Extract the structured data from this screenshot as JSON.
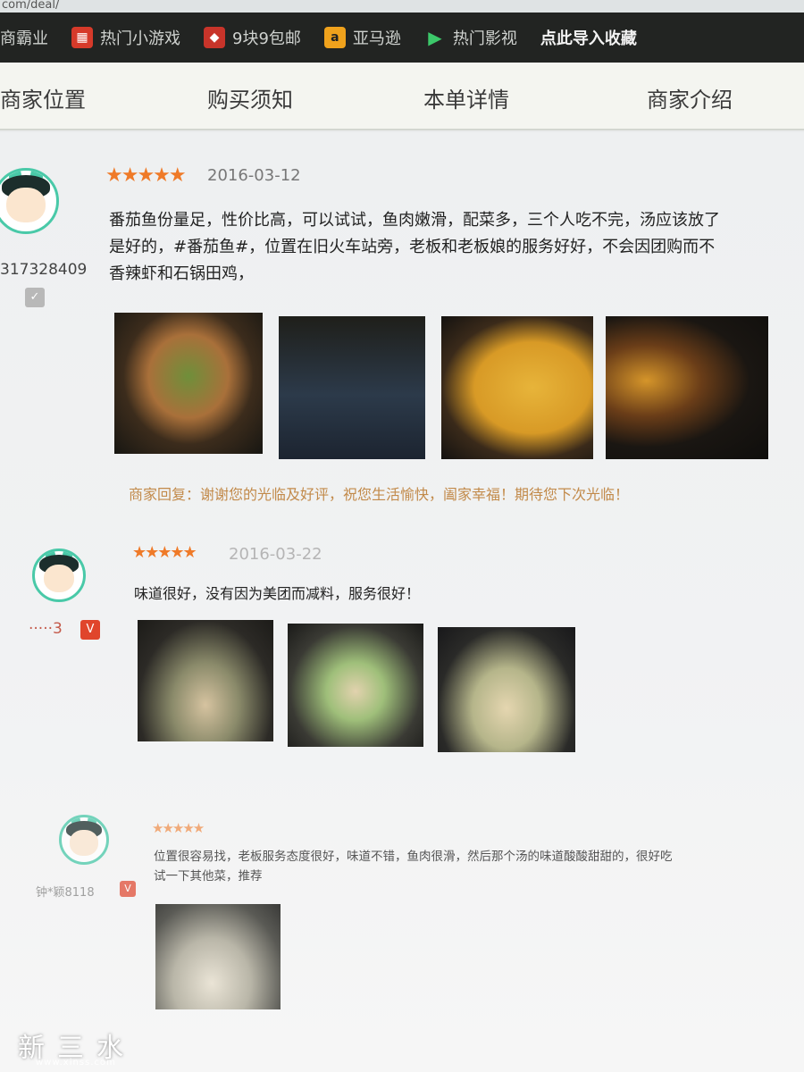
{
  "browser": {
    "url": "com/deal/",
    "bookmarks": [
      {
        "label": "商霸业",
        "icon": ""
      },
      {
        "label": "热门小游戏",
        "icon": "game-icon"
      },
      {
        "label": "9块9包邮",
        "icon": "tag-icon"
      },
      {
        "label": "亚马逊",
        "icon": "amazon-icon"
      },
      {
        "label": "热门影视",
        "icon": "play-icon"
      },
      {
        "label": "点此导入收藏",
        "icon": ""
      }
    ]
  },
  "tabs": [
    "商家位置",
    "购买须知",
    "本单详情",
    "商家介绍"
  ],
  "reviews": [
    {
      "user": "317328409",
      "stars": "★★★★★",
      "date": "2016-03-12",
      "text_lines": [
        "番茄鱼份量足，性价比高，可以试试，鱼肉嫩滑，配菜多，三个人吃不完，汤应该放了",
        "是好的，#番茄鱼#，位置在旧火车站旁，老板和老板娘的服务好好，不会因团购而不",
        "香辣虾和石锅田鸡，"
      ],
      "reply": "商家回复：谢谢您的光临及好评，祝您生活愉快，阖家幸福！期待您下次光临！"
    },
    {
      "user": "·····3",
      "stars": "★★★★★",
      "date": "2016-03-22",
      "text_lines": [
        "味道很好，没有因为美团而减料，服务很好！"
      ]
    },
    {
      "user": "钟*颖8118",
      "stars": "★★★★★",
      "text_lines": [
        "位置很容易找，老板服务态度很好，味道不错，鱼肉很滑，然后那个汤的味道酸酸甜甜的，很好吃",
        "试一下其他菜，推荐"
      ]
    }
  ],
  "watermark": {
    "title": "新三水",
    "url": "www.xinss.com"
  },
  "colors": {
    "accent_star": "#ef7a28",
    "avatar_border": "#49c9a8",
    "reply": "#c28a4a"
  }
}
